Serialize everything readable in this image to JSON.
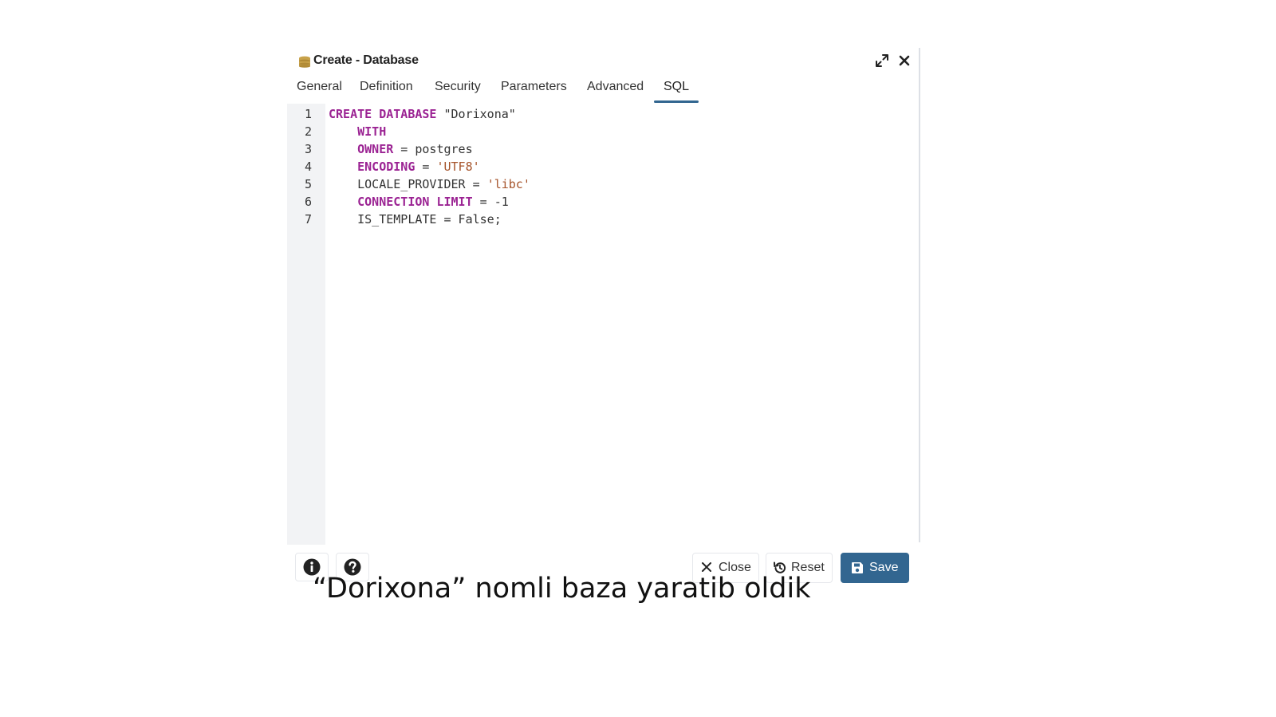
{
  "dialog": {
    "title": "Create - Database",
    "icons": {
      "title": "database-icon",
      "expand": "expand-icon",
      "close": "close-icon"
    }
  },
  "tabs": [
    {
      "label": "General",
      "active": false
    },
    {
      "label": "Definition",
      "active": false
    },
    {
      "label": "Security",
      "active": false
    },
    {
      "label": "Parameters",
      "active": false
    },
    {
      "label": "Advanced",
      "active": false
    },
    {
      "label": "SQL",
      "active": true
    }
  ],
  "sql": {
    "line_numbers": [
      "1",
      "2",
      "3",
      "4",
      "5",
      "6",
      "7"
    ],
    "lines": [
      [
        {
          "t": "CREATE DATABASE",
          "c": "kw"
        },
        {
          "t": " \"Dorixona\"",
          "c": ""
        }
      ],
      [
        {
          "t": "    ",
          "c": ""
        },
        {
          "t": "WITH",
          "c": "kw"
        }
      ],
      [
        {
          "t": "    ",
          "c": ""
        },
        {
          "t": "OWNER",
          "c": "kw"
        },
        {
          "t": " = postgres",
          "c": ""
        }
      ],
      [
        {
          "t": "    ",
          "c": ""
        },
        {
          "t": "ENCODING",
          "c": "kw"
        },
        {
          "t": " = ",
          "c": ""
        },
        {
          "t": "'UTF8'",
          "c": "str"
        }
      ],
      [
        {
          "t": "    LOCALE_PROVIDER = ",
          "c": ""
        },
        {
          "t": "'libc'",
          "c": "str"
        }
      ],
      [
        {
          "t": "    ",
          "c": ""
        },
        {
          "t": "CONNECTION LIMIT",
          "c": "kw"
        },
        {
          "t": " = -1",
          "c": ""
        }
      ],
      [
        {
          "t": "    IS_TEMPLATE = False;",
          "c": ""
        }
      ]
    ]
  },
  "footer": {
    "info_icon": "info-icon",
    "help_icon": "help-icon",
    "close_label": "Close",
    "reset_label": "Reset",
    "save_label": "Save"
  },
  "caption": "“Dorixona” nomli baza yaratib oldik",
  "colors": {
    "accent": "#326690",
    "keyword": "#9b2393",
    "string": "#a5532a",
    "gutter": "#f2f3f5",
    "db_icon": "#c8a24a"
  }
}
